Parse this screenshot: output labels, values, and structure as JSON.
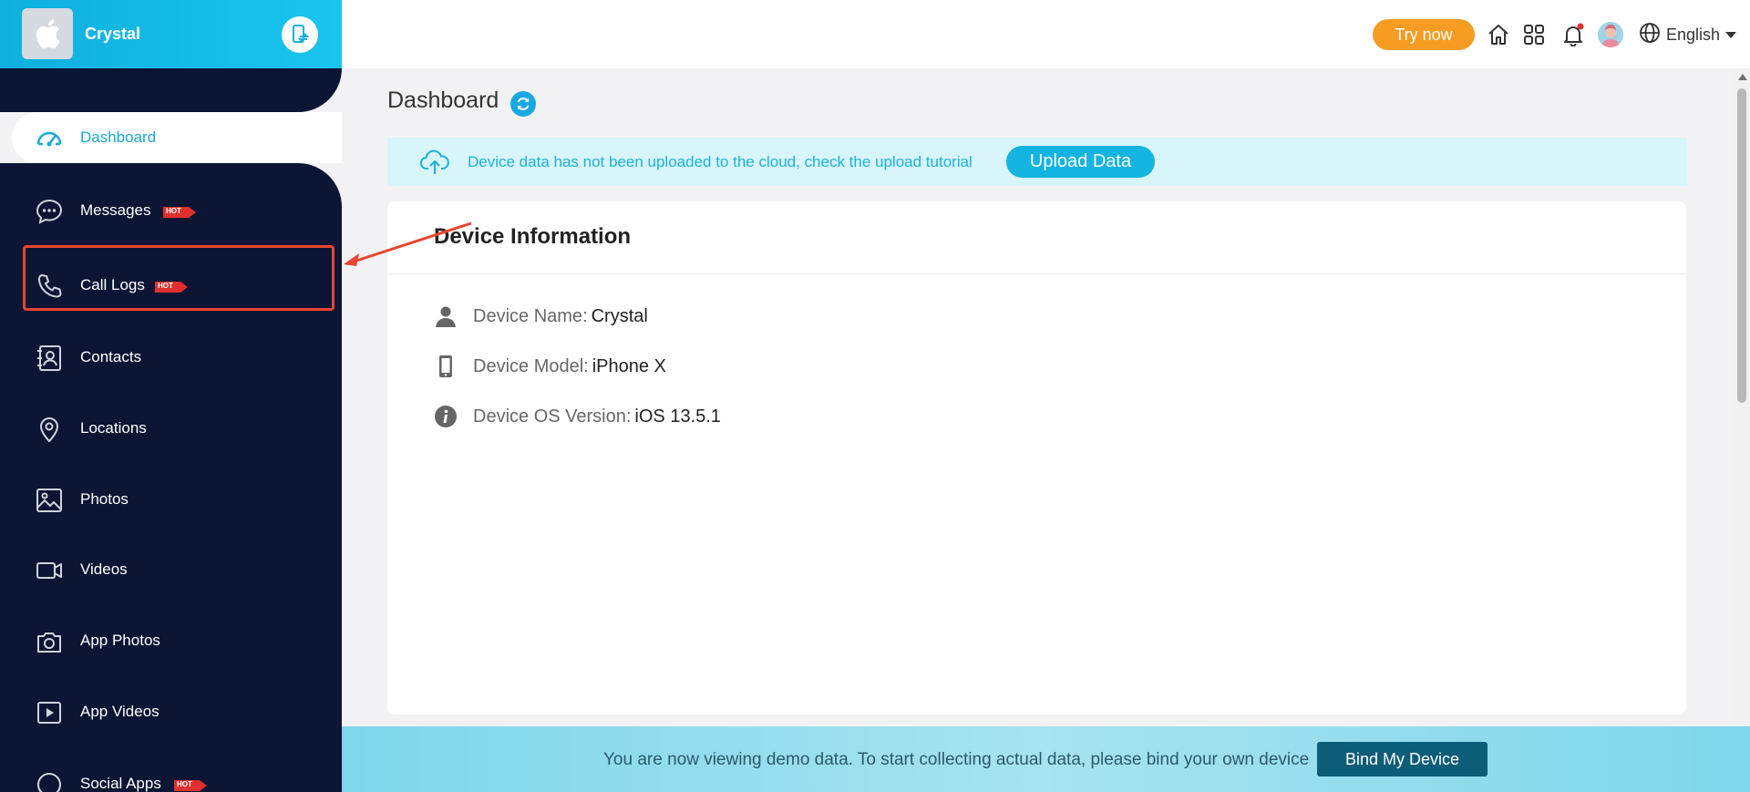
{
  "app": {
    "device_label": "Crystal"
  },
  "sidebar": {
    "items": [
      {
        "label": "Dashboard",
        "icon": "dashboard-icon",
        "hot": false
      },
      {
        "label": "Messages",
        "icon": "message-icon",
        "hot": true
      },
      {
        "label": "Call Logs",
        "icon": "phone-icon",
        "hot": true
      },
      {
        "label": "Contacts",
        "icon": "contacts-icon",
        "hot": false
      },
      {
        "label": "Locations",
        "icon": "location-pin-icon",
        "hot": false
      },
      {
        "label": "Photos",
        "icon": "photo-icon",
        "hot": false
      },
      {
        "label": "Videos",
        "icon": "video-camera-icon",
        "hot": false
      },
      {
        "label": "App Photos",
        "icon": "camera-icon",
        "hot": false
      },
      {
        "label": "App Videos",
        "icon": "play-icon",
        "hot": false
      },
      {
        "label": "Social Apps",
        "icon": "chat-bubble-icon",
        "hot": true
      }
    ],
    "hot_badge": "HOT"
  },
  "topbar": {
    "try_now": "Try now",
    "language": "English"
  },
  "main": {
    "title": "Dashboard",
    "notice": {
      "text": "Device data has not been uploaded to the cloud, check the upload tutorial",
      "button": "Upload Data"
    },
    "card": {
      "title": "Device Information",
      "rows": [
        {
          "key": "Device Name:",
          "value": "Crystal"
        },
        {
          "key": "Device Model:",
          "value": "iPhone X"
        },
        {
          "key": "Device OS Version:",
          "value": "iOS 13.5.1"
        }
      ]
    }
  },
  "demo_banner": {
    "text": "You are now viewing demo data. To start collecting actual data, please bind your own device",
    "button": "Bind My Device"
  },
  "colors": {
    "sidebar_bg": "#0c1533",
    "accent": "#18a9d6",
    "try_now": "#f79c23",
    "highlight": "#e8452f",
    "bind_button": "#0d5d78"
  }
}
